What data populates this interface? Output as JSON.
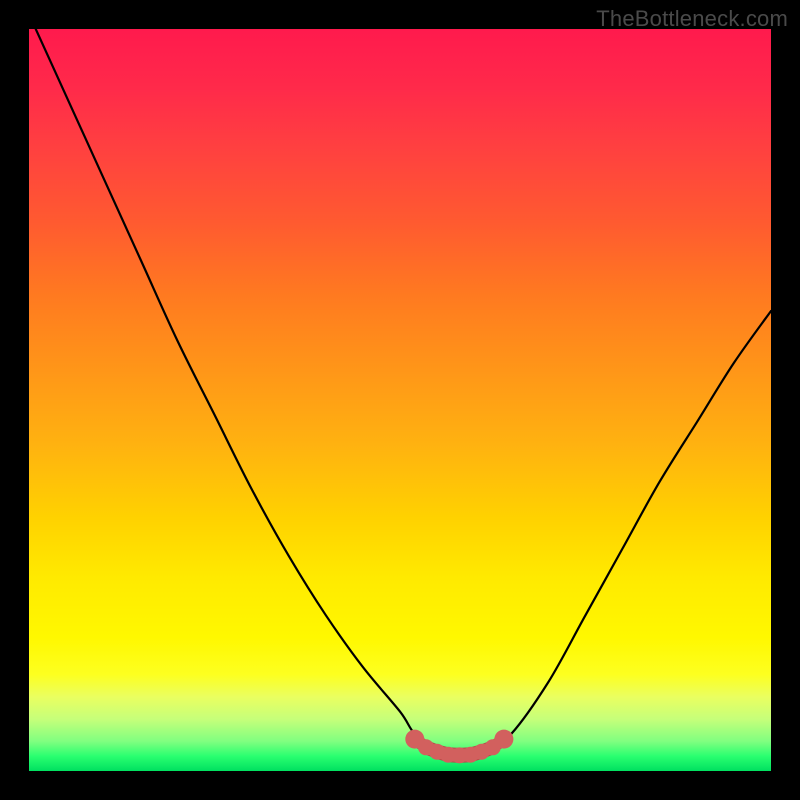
{
  "watermark": "TheBottleneck.com",
  "colors": {
    "frame": "#000000",
    "curve": "#000000",
    "marker_fill": "#d2605e",
    "marker_stroke": "#b84a48"
  },
  "chart_data": {
    "type": "line",
    "title": "",
    "xlabel": "",
    "ylabel": "",
    "xlim": [
      0,
      100
    ],
    "ylim": [
      0,
      100
    ],
    "series": [
      {
        "name": "bottleneck-curve",
        "x": [
          0,
          5,
          10,
          15,
          20,
          25,
          30,
          35,
          40,
          45,
          50,
          52,
          55,
          58,
          60,
          62,
          65,
          70,
          75,
          80,
          85,
          90,
          95,
          100
        ],
        "y": [
          102,
          91,
          80,
          69,
          58,
          48,
          38,
          29,
          21,
          14,
          8,
          5,
          3,
          2,
          2,
          3,
          5,
          12,
          21,
          30,
          39,
          47,
          55,
          62
        ]
      }
    ],
    "markers": {
      "name": "bottleneck-minimum-band",
      "x": [
        52,
        53.5,
        55,
        56.5,
        58,
        59.5,
        61,
        62.5,
        64
      ],
      "y": [
        4.3,
        3.2,
        2.6,
        2.2,
        2.1,
        2.2,
        2.6,
        3.2,
        4.3
      ]
    }
  }
}
